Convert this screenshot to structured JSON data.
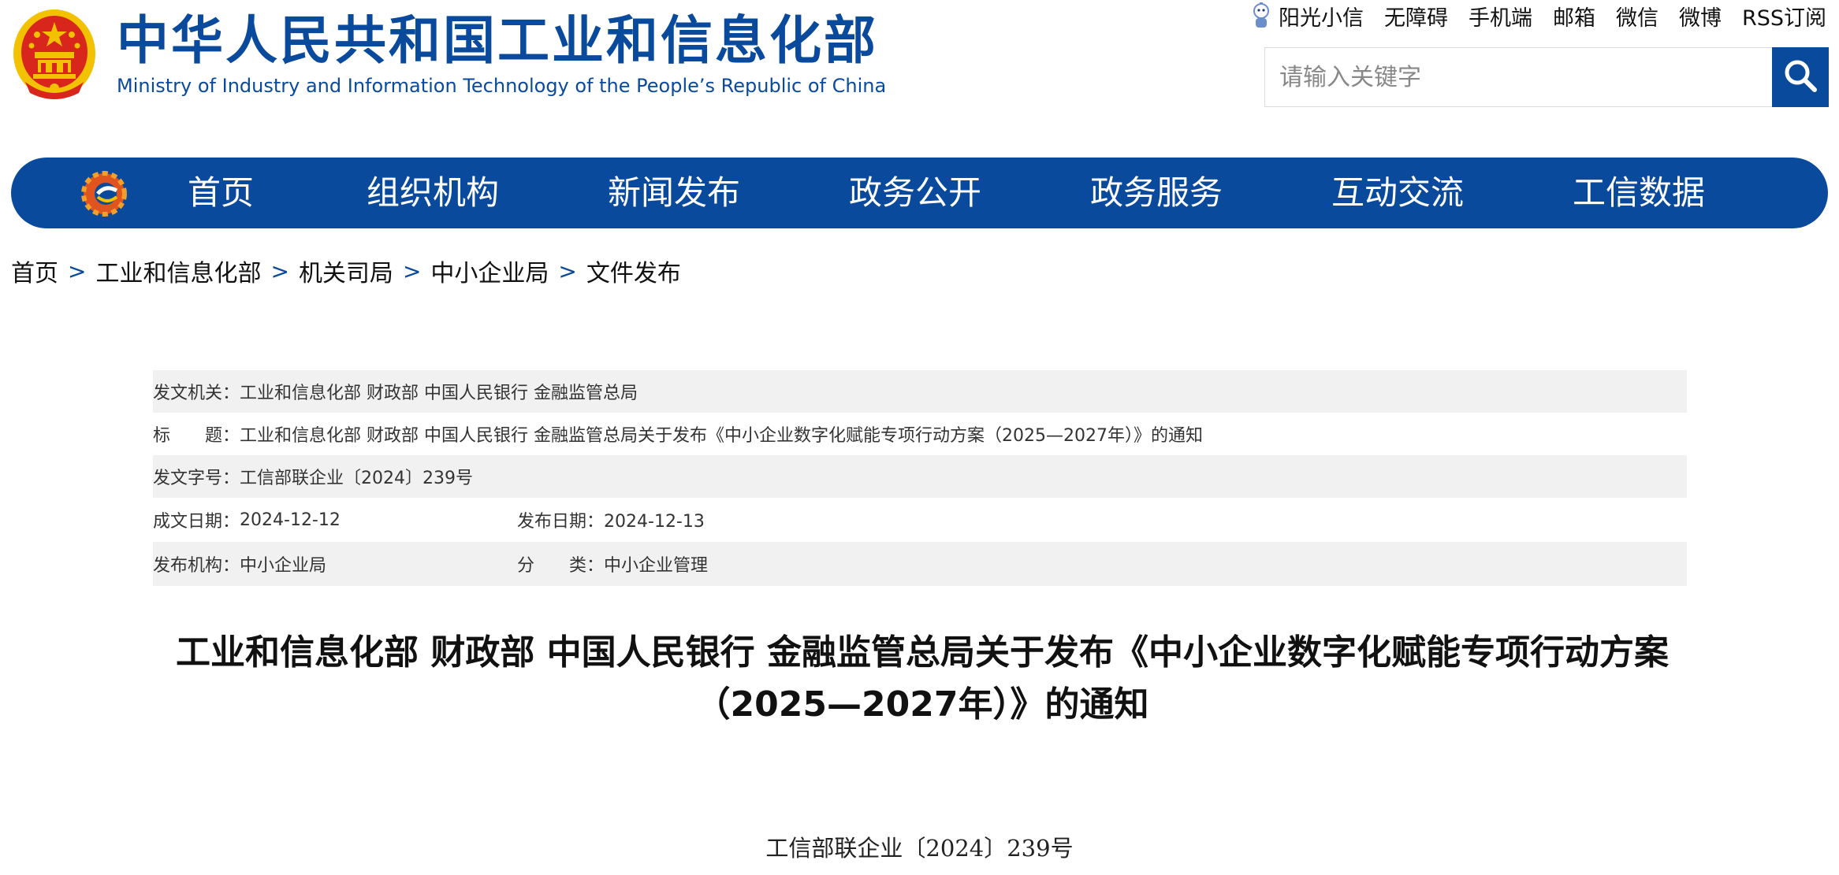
{
  "header": {
    "title_cn": "中华人民共和国工业和信息化部",
    "title_en": "Ministry of Industry and Information Technology of the People’s Republic of China"
  },
  "toplinks": [
    "阳光小信",
    "无障碍",
    "手机端",
    "邮箱",
    "微信",
    "微博",
    "RSS订阅"
  ],
  "search": {
    "placeholder": "请输入关键字"
  },
  "nav": [
    "首页",
    "组织机构",
    "新闻发布",
    "政务公开",
    "政务服务",
    "互动交流",
    "工信数据"
  ],
  "breadcrumb": [
    "首页",
    "工业和信息化部",
    "机关司局",
    "中小企业局",
    "文件发布"
  ],
  "breadcrumb_sep": ">",
  "info": {
    "issuer_label": "发文机关：",
    "issuer": "工业和信息化部 财政部 中国人民银行 金融监管总局",
    "title_label": "标　　题：",
    "title": "工业和信息化部 财政部 中国人民银行 金融监管总局关于发布《中小企业数字化赋能专项行动方案（2025—2027年）》的通知",
    "docno_label": "发文字号：",
    "docno": "工信部联企业〔2024〕239号",
    "created_label": "成文日期：",
    "created": "2024-12-12",
    "published_label": "发布日期：",
    "published": "2024-12-13",
    "org_label": "发布机构：",
    "org": "中小企业局",
    "category_label": "分　　类：",
    "category": "中小企业管理"
  },
  "doc": {
    "title_line1": "工业和信息化部 财政部 中国人民银行 金融监管总局关于发布《中小企业数字化赋能专项行动方案",
    "title_line2": "（2025—2027年）》的通知",
    "number": "工信部联企业〔2024〕239号"
  },
  "colors": {
    "brand": "#0a4a9c",
    "emblem_red": "#d8261c",
    "emblem_gold": "#f2c200",
    "row_gray": "#f1f1f1"
  },
  "icons": [
    "national-emblem-icon",
    "mascot-icon",
    "search-icon",
    "miit-logo-icon"
  ]
}
